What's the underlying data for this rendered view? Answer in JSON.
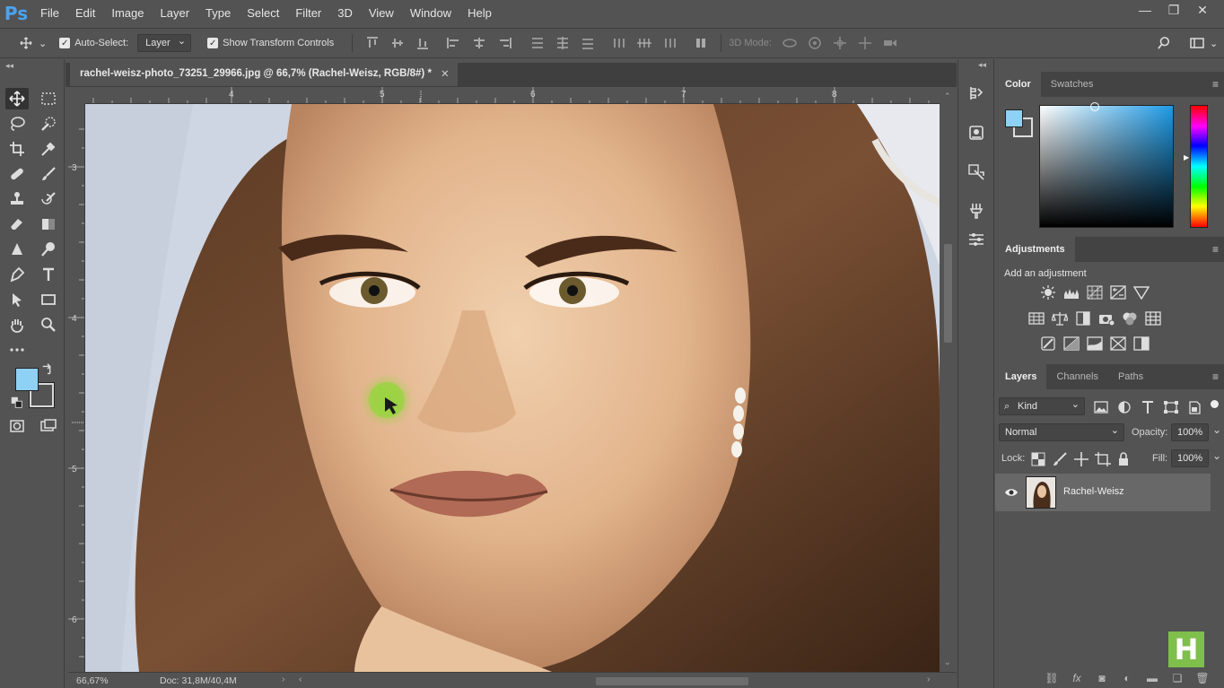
{
  "app": {
    "logo": "Ps"
  },
  "menu": [
    "File",
    "Edit",
    "Image",
    "Layer",
    "Type",
    "Select",
    "Filter",
    "3D",
    "View",
    "Window",
    "Help"
  ],
  "window_controls": {
    "minimize": "—",
    "restore": "❐",
    "close": "✕"
  },
  "options": {
    "auto_select_label": "Auto-Select:",
    "auto_select_checked": "✓",
    "auto_select_value": "Layer",
    "show_transform_label": "Show Transform Controls",
    "show_transform_checked": "✓",
    "mode_3d_label": "3D Mode:"
  },
  "document": {
    "tab_title": "rachel-weisz-photo_73251_29966.jpg @ 66,7% (Rachel-Weisz, RGB/8#) *",
    "tab_close": "✕",
    "ruler_h": [
      "4",
      "5",
      "6",
      "7",
      "8"
    ],
    "ruler_v": [
      "3",
      "4",
      "5",
      "6"
    ],
    "zoom": "66,67%",
    "doc_info": "Doc: 31,8M/40,4M"
  },
  "panels": {
    "color_tab": "Color",
    "swatches_tab": "Swatches",
    "adjustments_tab": "Adjustments",
    "adjustments_hint": "Add an adjustment",
    "layers_tab": "Layers",
    "channels_tab": "Channels",
    "paths_tab": "Paths",
    "kind_label": "Kind",
    "blend_mode": "Normal",
    "opacity_label": "Opacity:",
    "opacity_value": "100%",
    "lock_label": "Lock:",
    "fill_label": "Fill:",
    "fill_value": "100%",
    "layer_name": "Rachel-Weisz",
    "menu_glyph": "≡"
  },
  "colors": {
    "foreground": "#8fd1f4",
    "background": "#535353",
    "accent": "#4aa3f0",
    "watermark": "#7fbf4c"
  },
  "watermark": "H"
}
